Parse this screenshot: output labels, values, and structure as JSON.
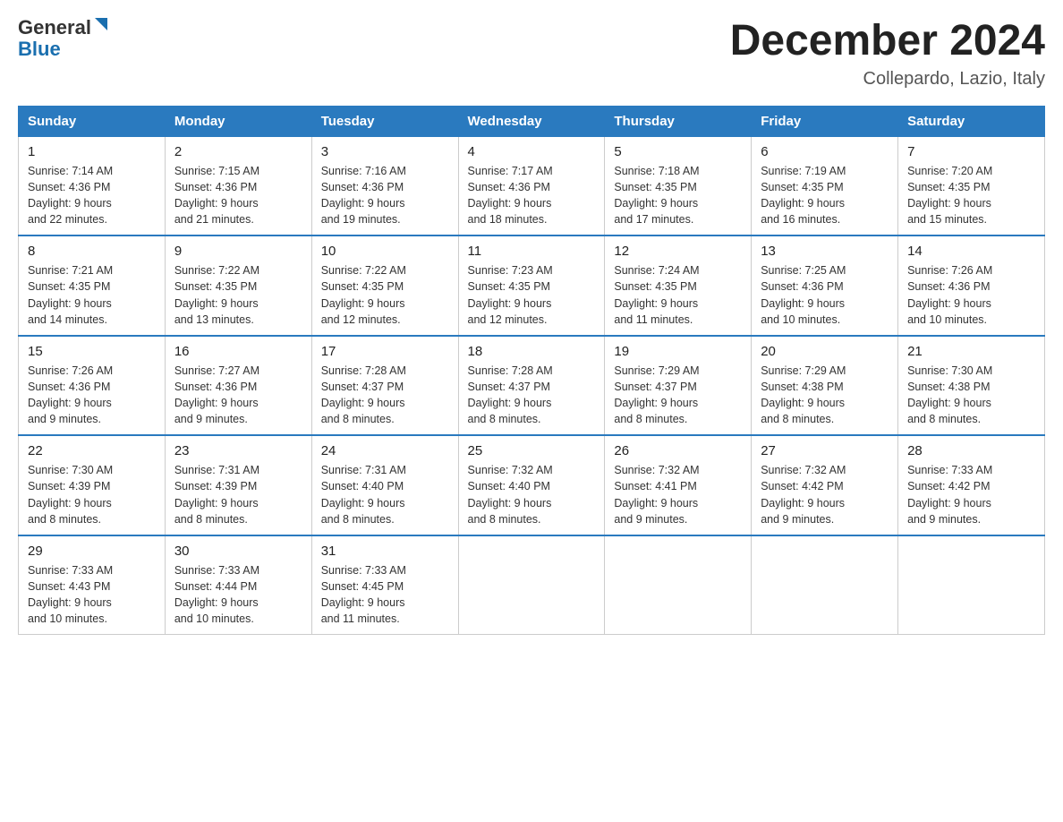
{
  "header": {
    "logo_general": "General",
    "logo_blue": "Blue",
    "month_title": "December 2024",
    "location": "Collepardo, Lazio, Italy"
  },
  "days_of_week": [
    "Sunday",
    "Monday",
    "Tuesday",
    "Wednesday",
    "Thursday",
    "Friday",
    "Saturday"
  ],
  "weeks": [
    [
      {
        "day": "1",
        "sunrise": "7:14 AM",
        "sunset": "4:36 PM",
        "daylight": "9 hours and 22 minutes."
      },
      {
        "day": "2",
        "sunrise": "7:15 AM",
        "sunset": "4:36 PM",
        "daylight": "9 hours and 21 minutes."
      },
      {
        "day": "3",
        "sunrise": "7:16 AM",
        "sunset": "4:36 PM",
        "daylight": "9 hours and 19 minutes."
      },
      {
        "day": "4",
        "sunrise": "7:17 AM",
        "sunset": "4:36 PM",
        "daylight": "9 hours and 18 minutes."
      },
      {
        "day": "5",
        "sunrise": "7:18 AM",
        "sunset": "4:35 PM",
        "daylight": "9 hours and 17 minutes."
      },
      {
        "day": "6",
        "sunrise": "7:19 AM",
        "sunset": "4:35 PM",
        "daylight": "9 hours and 16 minutes."
      },
      {
        "day": "7",
        "sunrise": "7:20 AM",
        "sunset": "4:35 PM",
        "daylight": "9 hours and 15 minutes."
      }
    ],
    [
      {
        "day": "8",
        "sunrise": "7:21 AM",
        "sunset": "4:35 PM",
        "daylight": "9 hours and 14 minutes."
      },
      {
        "day": "9",
        "sunrise": "7:22 AM",
        "sunset": "4:35 PM",
        "daylight": "9 hours and 13 minutes."
      },
      {
        "day": "10",
        "sunrise": "7:22 AM",
        "sunset": "4:35 PM",
        "daylight": "9 hours and 12 minutes."
      },
      {
        "day": "11",
        "sunrise": "7:23 AM",
        "sunset": "4:35 PM",
        "daylight": "9 hours and 12 minutes."
      },
      {
        "day": "12",
        "sunrise": "7:24 AM",
        "sunset": "4:35 PM",
        "daylight": "9 hours and 11 minutes."
      },
      {
        "day": "13",
        "sunrise": "7:25 AM",
        "sunset": "4:36 PM",
        "daylight": "9 hours and 10 minutes."
      },
      {
        "day": "14",
        "sunrise": "7:26 AM",
        "sunset": "4:36 PM",
        "daylight": "9 hours and 10 minutes."
      }
    ],
    [
      {
        "day": "15",
        "sunrise": "7:26 AM",
        "sunset": "4:36 PM",
        "daylight": "9 hours and 9 minutes."
      },
      {
        "day": "16",
        "sunrise": "7:27 AM",
        "sunset": "4:36 PM",
        "daylight": "9 hours and 9 minutes."
      },
      {
        "day": "17",
        "sunrise": "7:28 AM",
        "sunset": "4:37 PM",
        "daylight": "9 hours and 8 minutes."
      },
      {
        "day": "18",
        "sunrise": "7:28 AM",
        "sunset": "4:37 PM",
        "daylight": "9 hours and 8 minutes."
      },
      {
        "day": "19",
        "sunrise": "7:29 AM",
        "sunset": "4:37 PM",
        "daylight": "9 hours and 8 minutes."
      },
      {
        "day": "20",
        "sunrise": "7:29 AM",
        "sunset": "4:38 PM",
        "daylight": "9 hours and 8 minutes."
      },
      {
        "day": "21",
        "sunrise": "7:30 AM",
        "sunset": "4:38 PM",
        "daylight": "9 hours and 8 minutes."
      }
    ],
    [
      {
        "day": "22",
        "sunrise": "7:30 AM",
        "sunset": "4:39 PM",
        "daylight": "9 hours and 8 minutes."
      },
      {
        "day": "23",
        "sunrise": "7:31 AM",
        "sunset": "4:39 PM",
        "daylight": "9 hours and 8 minutes."
      },
      {
        "day": "24",
        "sunrise": "7:31 AM",
        "sunset": "4:40 PM",
        "daylight": "9 hours and 8 minutes."
      },
      {
        "day": "25",
        "sunrise": "7:32 AM",
        "sunset": "4:40 PM",
        "daylight": "9 hours and 8 minutes."
      },
      {
        "day": "26",
        "sunrise": "7:32 AM",
        "sunset": "4:41 PM",
        "daylight": "9 hours and 9 minutes."
      },
      {
        "day": "27",
        "sunrise": "7:32 AM",
        "sunset": "4:42 PM",
        "daylight": "9 hours and 9 minutes."
      },
      {
        "day": "28",
        "sunrise": "7:33 AM",
        "sunset": "4:42 PM",
        "daylight": "9 hours and 9 minutes."
      }
    ],
    [
      {
        "day": "29",
        "sunrise": "7:33 AM",
        "sunset": "4:43 PM",
        "daylight": "9 hours and 10 minutes."
      },
      {
        "day": "30",
        "sunrise": "7:33 AM",
        "sunset": "4:44 PM",
        "daylight": "9 hours and 10 minutes."
      },
      {
        "day": "31",
        "sunrise": "7:33 AM",
        "sunset": "4:45 PM",
        "daylight": "9 hours and 11 minutes."
      },
      null,
      null,
      null,
      null
    ]
  ],
  "labels": {
    "sunrise": "Sunrise:",
    "sunset": "Sunset:",
    "daylight": "Daylight:"
  }
}
